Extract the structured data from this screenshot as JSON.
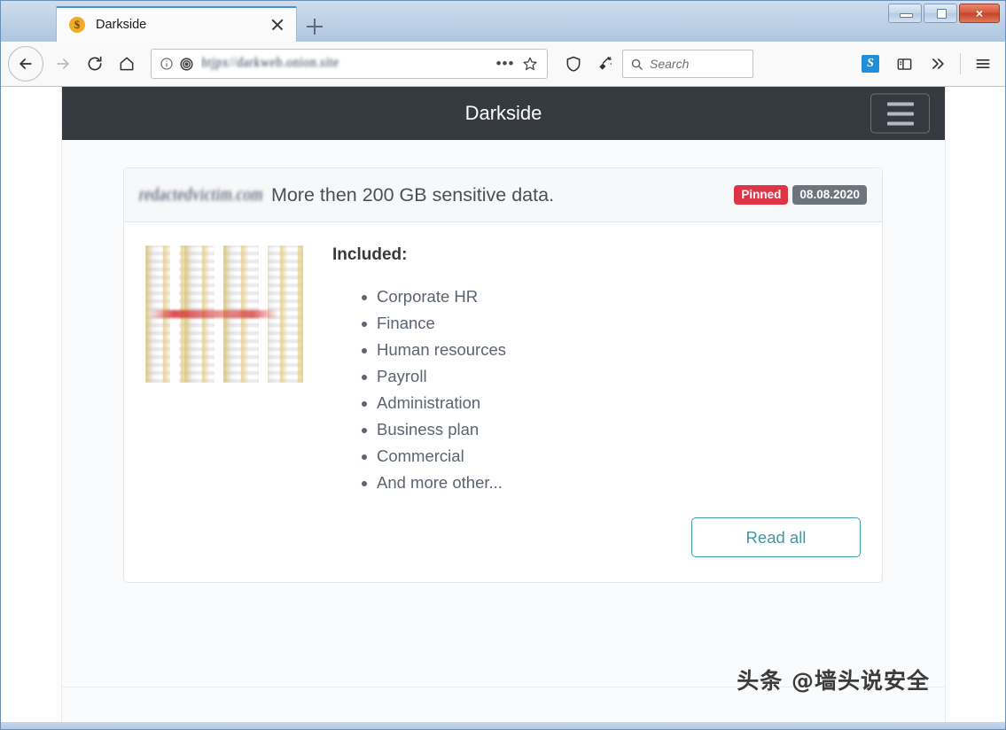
{
  "browser": {
    "tab": {
      "title": "Darkside",
      "favicon_icon": "dollar-coin-icon",
      "favicon_glyph": "$",
      "close_icon": "close-icon"
    },
    "new_tab_icon": "plus-icon",
    "window_buttons": {
      "minimize": "minimize-icon",
      "maximize": "maximize-icon",
      "close": "×"
    },
    "toolbar": {
      "back_icon": "arrow-left-icon",
      "forward_icon": "arrow-right-icon",
      "reload_icon": "reload-icon",
      "home_icon": "home-icon",
      "identity_icon": "info-circle-icon",
      "onion_icon": "onion-circle-icon",
      "url_value": "htjpx//darkweb.onion.site",
      "page_actions_icon": "ellipsis-icon",
      "bookmark_icon": "star-icon",
      "shield_icon": "shield-icon",
      "new_identity_icon": "broom-sparkle-icon",
      "extension_s_icon": "skype-extension-icon",
      "extension_s_glyph": "S",
      "sidebar_icon": "sidebar-panel-icon",
      "overflow_icon": "double-chevron-right-icon",
      "menu_icon": "hamburger-menu-icon"
    },
    "search": {
      "icon": "search-icon",
      "placeholder": "Search",
      "value": ""
    }
  },
  "site": {
    "navbar": {
      "brand": "Darkside",
      "toggler_icon": "hamburger-menu-icon"
    },
    "card": {
      "header": {
        "redacted_domain": "redactedvictim.com",
        "title": "More then 200 GB sensitive data.",
        "badges": [
          {
            "label": "Pinned",
            "color": "#dc3545",
            "name": "status-badge-pinned"
          },
          {
            "label": "08.08.2020",
            "color": "#6c757d",
            "name": "date-badge"
          }
        ]
      },
      "thumbnail_alt": "censored-screenshot-thumbnail",
      "included_label": "Included:",
      "included_items": [
        "Corporate HR",
        "Finance",
        "Human resources",
        "Payroll",
        "Administration",
        "Business plan",
        "Commercial",
        "And more other..."
      ],
      "read_all_label": "Read all"
    }
  },
  "watermark": "头条 @墙头说安全",
  "colors": {
    "navbar_dark": "#343a40",
    "pinned_red": "#dc3545",
    "date_gray": "#6c757d",
    "readall_teal": "#3a9aa8"
  }
}
